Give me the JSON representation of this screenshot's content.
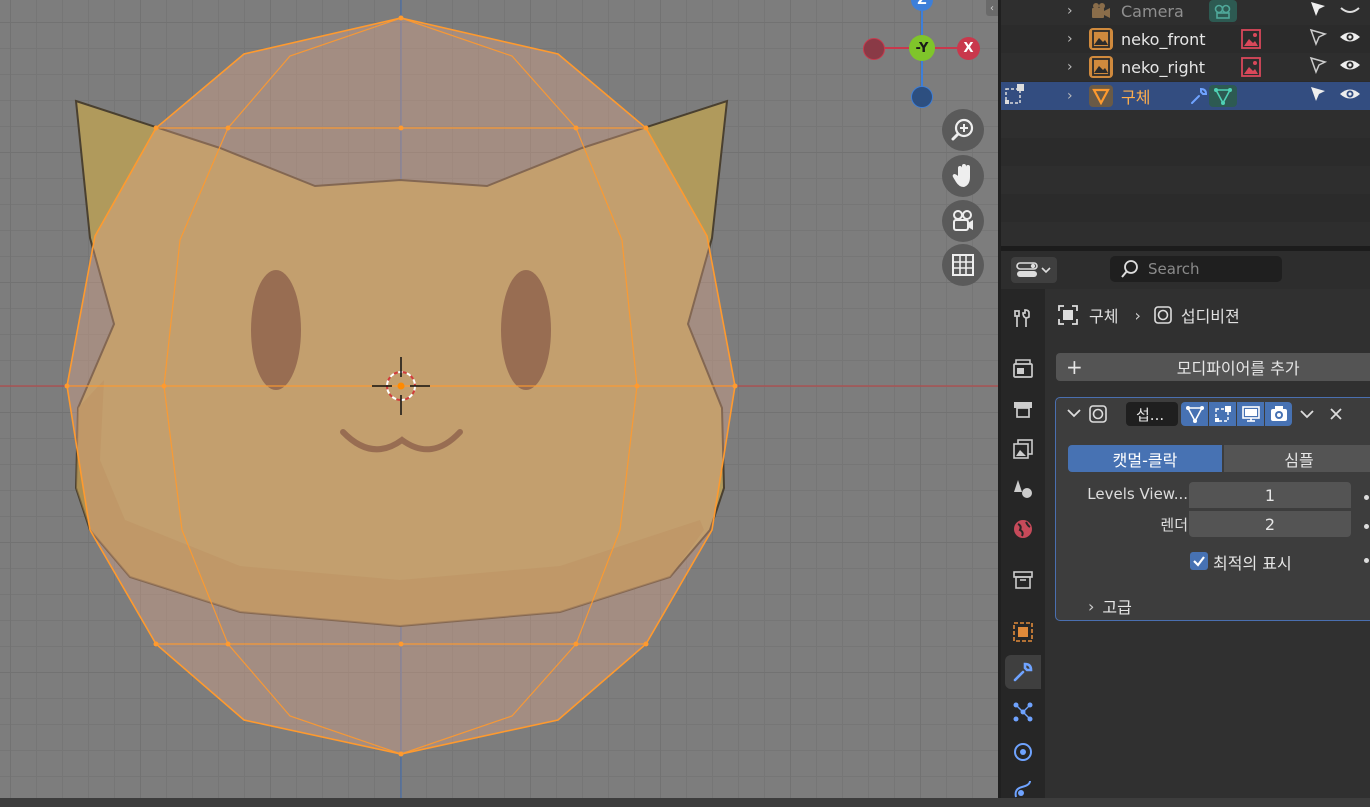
{
  "viewport": {
    "gizmo": {
      "z_label": "Z",
      "y_label": "-Y",
      "x_label": "X"
    },
    "colors": {
      "mesh_wire": "#ff9a2e",
      "axis_x": "#c9384c",
      "axis_y": "#7fc52a",
      "axis_z": "#3d7fd9"
    }
  },
  "outliner": {
    "items": [
      {
        "label": "Camera",
        "type": "camera",
        "dimmed": true
      },
      {
        "label": "neko_front",
        "type": "image"
      },
      {
        "label": "neko_right",
        "type": "image"
      },
      {
        "label": "구체",
        "type": "mesh",
        "selected": true
      }
    ]
  },
  "properties": {
    "search_placeholder": "Search",
    "breadcrumb": {
      "object": "구체",
      "modifier": "섭디비젼"
    },
    "add_modifier_label": "모디파이어를 추가",
    "modifier": {
      "name": "섭...",
      "mode_catmull": "캣멀-클락",
      "mode_simple": "심플",
      "levels_viewport_label": "Levels View...",
      "levels_viewport_value": "1",
      "render_label": "렌더",
      "render_value": "2",
      "optimal_display_label": "최적의 표시",
      "optimal_display_checked": true,
      "advanced_label": "고급"
    }
  }
}
